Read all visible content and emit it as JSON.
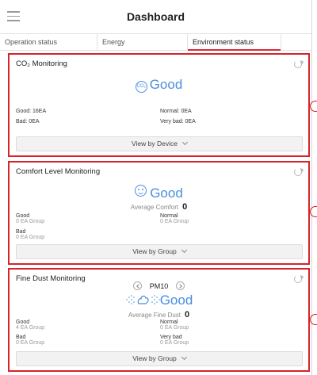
{
  "header": {
    "title": "Dashboard"
  },
  "tabs": [
    {
      "label": "Operation status"
    },
    {
      "label": "Energy"
    },
    {
      "label": "Environment status"
    }
  ],
  "co2": {
    "title": "CO₂ Monitoring",
    "badge": "CO₂",
    "status": "Good",
    "stats": {
      "good": "Good: 16EA",
      "normal": "Normal: 0EA",
      "bad": "Bad: 0EA",
      "very_bad": "Very bad: 0EA"
    },
    "button": "View by Device"
  },
  "comfort": {
    "title": "Comfort Level Monitoring",
    "status": "Good",
    "avg_label": "Average Comfort",
    "avg_value": "0",
    "stats": {
      "good": "Good",
      "good_sub": "0 EA Group",
      "normal": "Normal",
      "normal_sub": "0 EA Group",
      "bad": "Bad",
      "bad_sub": "0 EA Group"
    },
    "button": "View by Group"
  },
  "dust": {
    "title": "Fine Dust Monitoring",
    "selector": "PM10",
    "status": "Good",
    "avg_label": "Average Fine Dust",
    "avg_value": "0",
    "stats": {
      "good": "Good",
      "good_sub": "4 EA Group",
      "normal": "Normal",
      "normal_sub": "0 EA Group",
      "bad": "Bad",
      "bad_sub": "0 EA Group",
      "very_bad": "Very bad",
      "very_bad_sub": "0 EA Group"
    },
    "button": "View by Group"
  },
  "colors": {
    "accent": "#4a8ee0",
    "highlight": "#d8232a",
    "tab_underline": "#d9293c"
  }
}
